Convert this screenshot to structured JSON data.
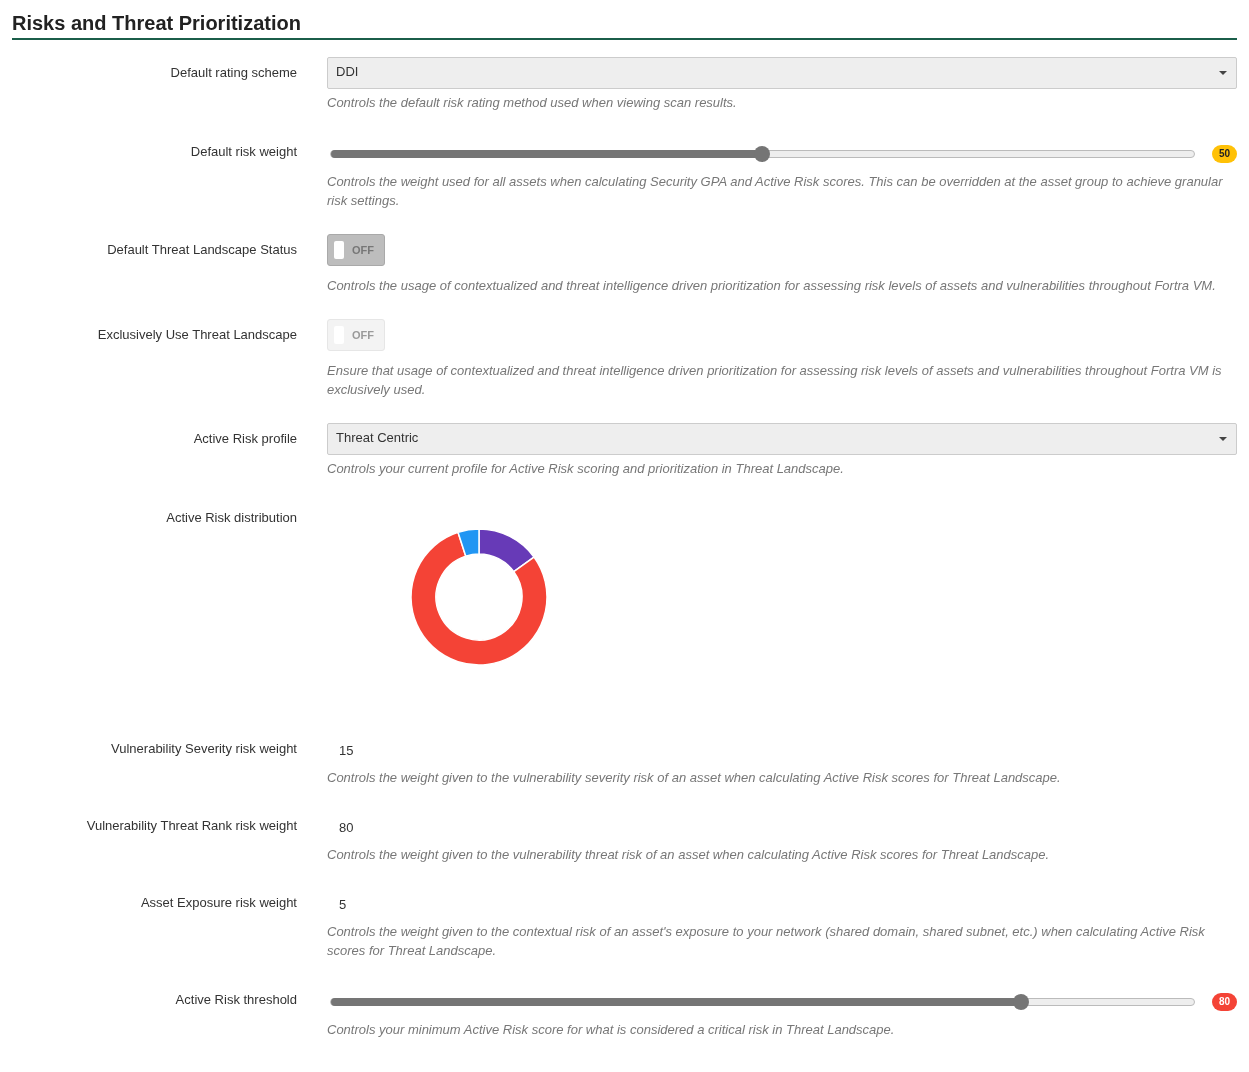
{
  "title": "Risks and Threat Prioritization",
  "rows": [
    {
      "kind": "select",
      "label": "Default rating scheme",
      "value": "DDI",
      "description": "Controls the default risk rating method used when viewing scan results."
    },
    {
      "kind": "slider",
      "label": "Default risk weight",
      "level": 0.5,
      "reading": "50",
      "color": "#ffc107",
      "description": "Controls the weight used for all assets when calculating Security GPA and Active Risk scores. This can be overridden at the asset group to achieve granular risk settings."
    },
    {
      "kind": "toggle",
      "label": "Default Threat Landscape Status",
      "on": false,
      "disabled": false,
      "state_text": "OFF",
      "description": "Controls the usage of contextualized and threat intelligence driven prioritization for assessing risk levels of assets and vulnerabilities throughout Fortra VM."
    },
    {
      "kind": "toggle",
      "label": "Exclusively Use Threat Landscape",
      "on": false,
      "disabled": true,
      "state_text": "OFF",
      "description": "Ensure that usage of contextualized and threat intelligence driven prioritization for assessing risk levels of assets and vulnerabilities throughout Fortra VM is exclusively used."
    },
    {
      "kind": "select",
      "label": "Active Risk profile",
      "value": "Threat Centric",
      "description": "Controls your current profile for Active Risk scoring and prioritization in Threat Landscape."
    },
    {
      "kind": "donut",
      "label": "Active Risk distribution"
    },
    {
      "kind": "number",
      "label": "Vulnerability Severity risk weight",
      "value": "15",
      "description": "Controls the weight given to the vulnerability severity risk of an asset when calculating Active Risk scores for Threat Landscape."
    },
    {
      "kind": "number",
      "label": "Vulnerability Threat Rank risk weight",
      "value": "80",
      "description": "Controls the weight given to the vulnerability threat risk of an asset when calculating Active Risk scores for Threat Landscape."
    },
    {
      "kind": "number",
      "label": "Asset Exposure risk weight",
      "value": "5",
      "description": "Controls the weight given to the contextual risk of an asset's exposure to your network (shared domain, shared subnet, etc.) when calculating Active Risk scores for Threat Landscape."
    },
    {
      "kind": "slider",
      "label": "Active Risk threshold",
      "level": 0.8,
      "reading": "80",
      "color": "#f44336",
      "description": "Controls your minimum Active Risk score for what is considered a critical risk in Threat Landscape."
    }
  ]
}
